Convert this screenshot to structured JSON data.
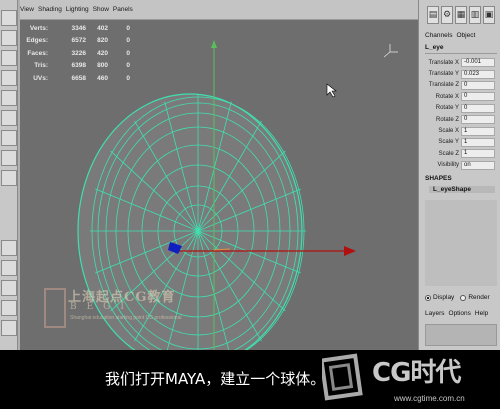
{
  "viewport": {
    "menu": [
      "View",
      "Shading",
      "Lighting",
      "Show",
      "Panels"
    ],
    "hud": [
      {
        "label": "Verts:",
        "v1": "3346",
        "v2": "402",
        "v3": "0"
      },
      {
        "label": "Edges:",
        "v1": "6572",
        "v2": "820",
        "v3": "0"
      },
      {
        "label": "Faces:",
        "v1": "3226",
        "v2": "420",
        "v3": "0"
      },
      {
        "label": "Tris:",
        "v1": "6398",
        "v2": "800",
        "v3": "0"
      },
      {
        "label": "UVs:",
        "v1": "6658",
        "v2": "460",
        "v3": "0"
      }
    ]
  },
  "channel_box": {
    "tabs": [
      "Channels",
      "Object"
    ],
    "object_name": "L_eye",
    "attributes": [
      {
        "label": "Translate X",
        "value": "-0.001"
      },
      {
        "label": "Translate Y",
        "value": "0.023"
      },
      {
        "label": "Translate Z",
        "value": "0"
      },
      {
        "label": "Rotate X",
        "value": "0"
      },
      {
        "label": "Rotate Y",
        "value": "0"
      },
      {
        "label": "Rotate Z",
        "value": "0"
      },
      {
        "label": "Scale X",
        "value": "1"
      },
      {
        "label": "Scale Y",
        "value": "1"
      },
      {
        "label": "Scale Z",
        "value": "1"
      },
      {
        "label": "Visibility",
        "value": "on"
      }
    ],
    "shapes_header": "SHAPES",
    "shape_name": "L_eyeShape"
  },
  "layer_editor": {
    "radios": [
      {
        "label": "Display",
        "selected": true
      },
      {
        "label": "Render",
        "selected": false
      }
    ],
    "menu": [
      "Layers",
      "Options",
      "Help"
    ]
  },
  "watermark": {
    "title": "上海起点CG教育",
    "letters": "BEGI",
    "subtitle": "Shanghai education starting point CG professional"
  },
  "caption": "我们打开MAYA，建立一个球体。",
  "brand": {
    "name": "CG时代",
    "url": "www.cgtime.com.cn"
  },
  "colors": {
    "wireframe": "#3fe0b0",
    "viewport_bg": "#6e6e6e",
    "axis_x": "#b01010",
    "axis_z": "#1020c0"
  }
}
